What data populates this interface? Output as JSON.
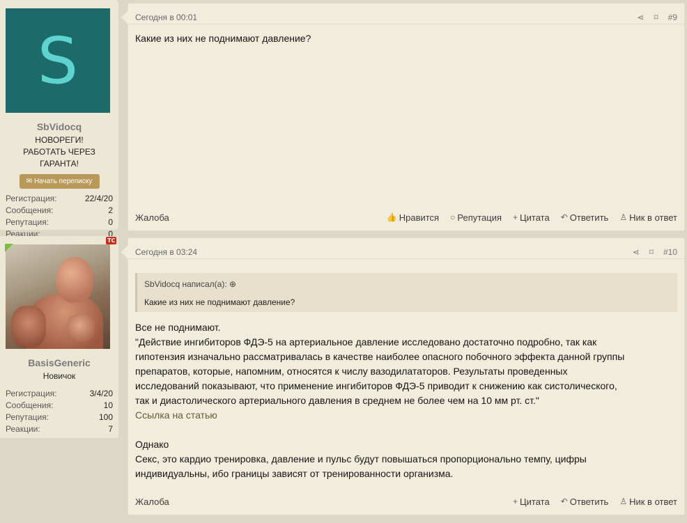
{
  "posts": [
    {
      "user": {
        "avatar_letter": "S",
        "name": "SbVidocq",
        "title": "НОВОРЕГИ! РАБОТАТЬ ЧЕРЕЗ ГАРАНТА!",
        "message_button": "Начать переписку",
        "stats": [
          {
            "label": "Регистрация:",
            "value": "22/4/20"
          },
          {
            "label": "Сообщения:",
            "value": "2"
          },
          {
            "label": "Репутация:",
            "value": "0"
          },
          {
            "label": "Реакции:",
            "value": "0"
          }
        ]
      },
      "date": "Сегодня в 00:01",
      "number": "#9",
      "text": "Какие из них не поднимают давление?",
      "footer": {
        "report": "Жалоба",
        "like": "Нравится",
        "reputation": "Репутация",
        "quote": "Цитата",
        "reply": "Ответить",
        "nick": "Ник в ответ"
      }
    },
    {
      "user": {
        "badge": "TC",
        "name": "BasisGeneric",
        "title": "Новичок",
        "stats": [
          {
            "label": "Регистрация:",
            "value": "3/4/20"
          },
          {
            "label": "Сообщения:",
            "value": "10"
          },
          {
            "label": "Репутация:",
            "value": "100"
          },
          {
            "label": "Реакции:",
            "value": "7"
          }
        ]
      },
      "date": "Сегодня в 03:24",
      "number": "#10",
      "quote": {
        "header": "SbVidocq написал(а):",
        "text": "Какие из них не поднимают давление?"
      },
      "lines": [
        "Все не поднимают.",
        "\"Действие ингибиторов ФДЭ-5 на артериальное давление исследовано достаточно подробно, так как",
        "гипотензия изначально рассматривалась в качестве наиболее опасного побочного эффекта данной группы",
        "препаратов, которые, напомним, относятся к числу вазодилататоров. Результаты проведенных",
        "исследований показывают, что применение ингибиторов ФДЭ-5 приводит к снижению как систолического,",
        "так и диастолического артериального давления в среднем не более чем на 10 мм рт. ст.\""
      ],
      "link": "Ссылка на статью",
      "lines2": [
        "Однако",
        "Секс, это кардио тренировка, давление и пульс будут повышаться пропорционально темпу, цифры",
        "индивидуальны, ибо границы зависят от тренированности организма."
      ],
      "footer": {
        "report": "Жалоба",
        "quote": "Цитата",
        "reply": "Ответить",
        "nick": "Ник в ответ"
      }
    }
  ]
}
